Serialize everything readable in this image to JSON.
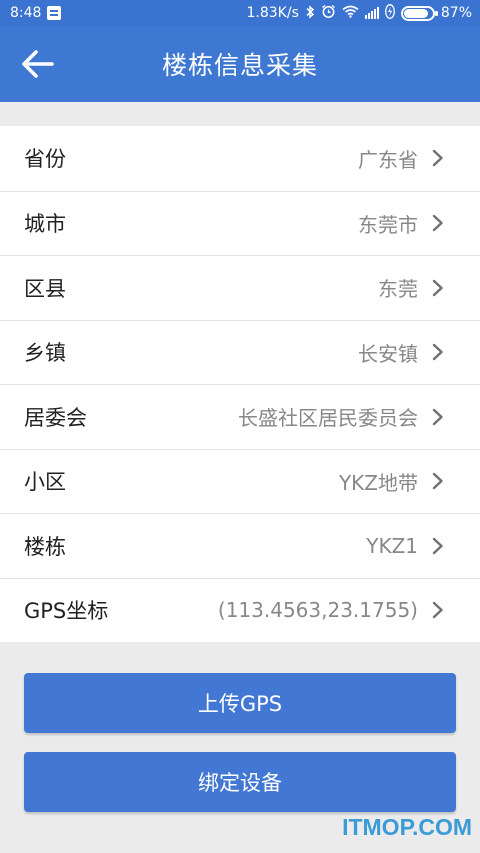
{
  "status_bar": {
    "time": "8:48",
    "speed": "1.83K/s",
    "battery_percent": "87%",
    "battery_level": 0.87,
    "icons": [
      "notification-icon",
      "bluetooth-icon",
      "alarm-icon",
      "wifi-icon",
      "signal-icon",
      "charging-icon",
      "battery-icon"
    ]
  },
  "header": {
    "title": "楼栋信息采集",
    "back_icon": "arrow-left-icon"
  },
  "rows": [
    {
      "label": "省份",
      "value": "广东省"
    },
    {
      "label": "城市",
      "value": "东莞市"
    },
    {
      "label": "区县",
      "value": "东莞"
    },
    {
      "label": "乡镇",
      "value": "长安镇"
    },
    {
      "label": "居委会",
      "value": "长盛社区居民委员会"
    },
    {
      "label": "小区",
      "value": "YKZ地带"
    },
    {
      "label": "楼栋",
      "value": "YKZ1"
    },
    {
      "label": "GPS坐标",
      "value": "(113.4563,23.1755)"
    }
  ],
  "buttons": {
    "upload_gps": "上传GPS",
    "bind_device": "绑定设备"
  },
  "watermark": "ITMOP.COM",
  "colors": {
    "primary": "#3f78d2",
    "button": "#4278d3",
    "background": "#ebebeb"
  }
}
